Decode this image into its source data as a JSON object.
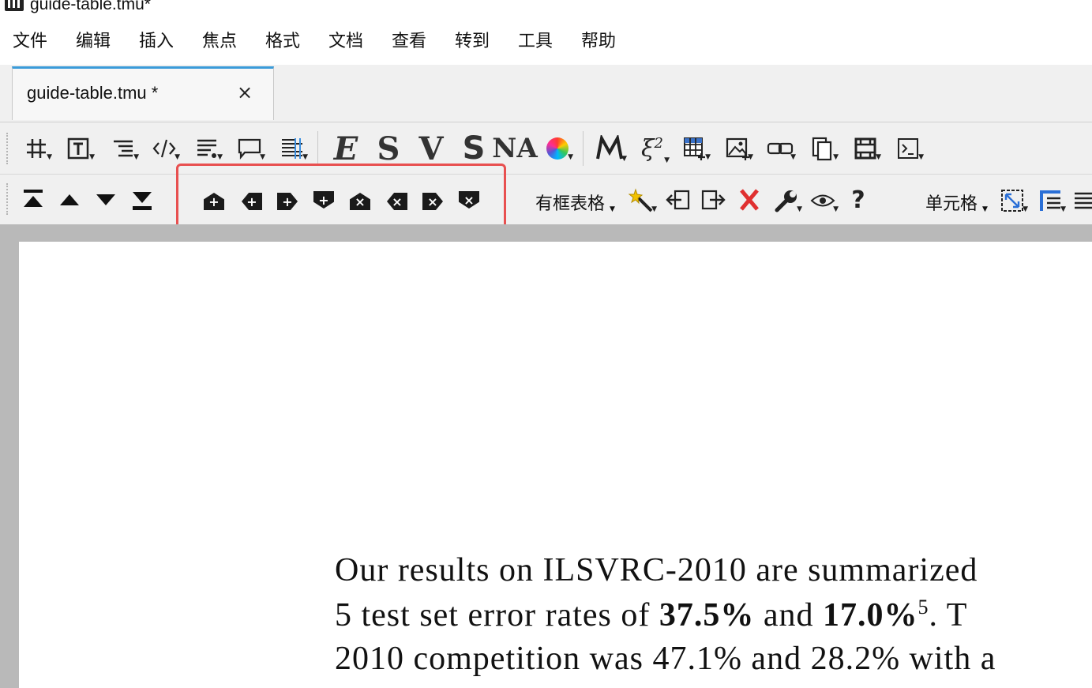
{
  "window": {
    "title": "guide-table.tmu*"
  },
  "menubar": {
    "items": [
      "文件",
      "编辑",
      "插入",
      "焦点",
      "格式",
      "文档",
      "查看",
      "转到",
      "工具",
      "帮助"
    ]
  },
  "tab": {
    "label": "guide-table.tmu *",
    "close_glyph": "×"
  },
  "toolbar1": {
    "icons": [
      "hash-icon",
      "text-box-icon",
      "align-icon",
      "code-icon",
      "list-icon",
      "comment-icon",
      "grid-lines-icon"
    ],
    "letters": [
      "E",
      "S",
      "V",
      "S",
      "NA"
    ],
    "right_icons": [
      "color-wheel-icon",
      "math-m-icon",
      "xi-squared-icon",
      "table-insert-icon",
      "image-insert-icon",
      "link-icon",
      "copy-pages-icon",
      "film-icon",
      "terminal-icon"
    ]
  },
  "toolbar2": {
    "nav_icons": [
      "move-top-icon",
      "move-up-icon",
      "move-down-icon",
      "move-bottom-icon"
    ],
    "row_col_icons": [
      "insert-row-above-icon",
      "insert-column-left-icon",
      "insert-column-right-icon",
      "insert-row-below-icon",
      "delete-row-above-icon",
      "delete-column-left-icon",
      "delete-column-right-icon",
      "delete-row-below-icon"
    ],
    "table_style_label": "有框表格",
    "cell_label": "单元格"
  },
  "document": {
    "line1": "Our results on ILSVRC-2010 are summarized",
    "line2_pre": "5 test set error rates of ",
    "line2_b1": "37.5%",
    "line2_mid": " and ",
    "line2_b2": "17.0%",
    "line2_sup": "5",
    "line2_post": ". T",
    "line3": "2010 competition was 47.1% and 28.2% with a"
  }
}
